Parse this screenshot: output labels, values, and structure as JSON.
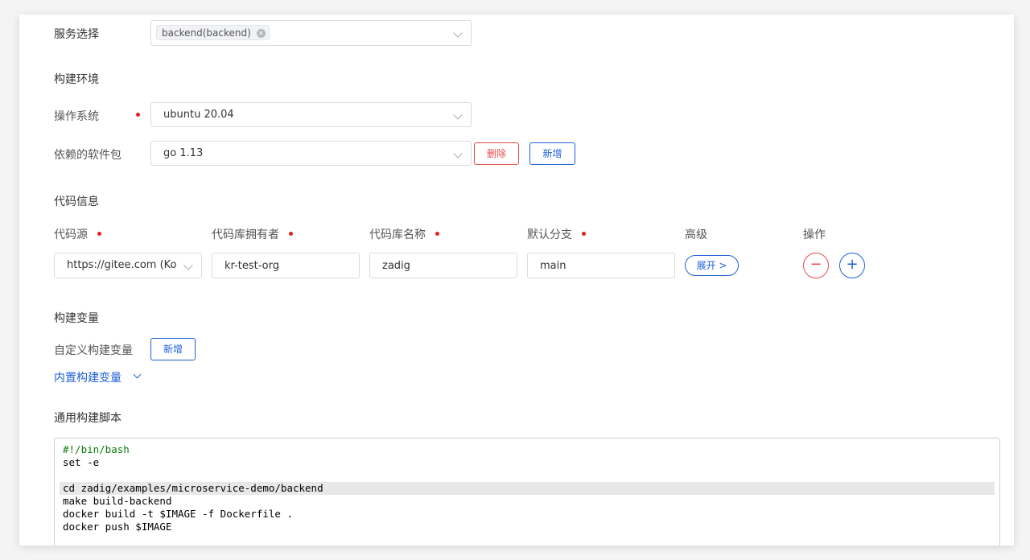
{
  "service": {
    "label": "服务选择",
    "tag": "backend(backend)"
  },
  "build_env": {
    "section_title": "构建环境",
    "os_label": "操作系统",
    "os_value": "ubuntu 20.04",
    "deps_label": "依赖的软件包",
    "deps_value": "go 1.13",
    "delete_label": "删除",
    "add_label": "新增"
  },
  "code_info": {
    "section_title": "代码信息",
    "headers": {
      "source": "代码源",
      "owner": "代码库拥有者",
      "repo": "代码库名称",
      "branch": "默认分支",
      "advanced": "高级",
      "actions": "操作"
    },
    "row": {
      "source": "https://gitee.com (Kode",
      "owner": "kr-test-org",
      "repo": "zadig",
      "branch": "main",
      "expand": "展开 >"
    }
  },
  "build_vars": {
    "section_title": "构建变量",
    "custom_label": "自定义构建变量",
    "add_label": "新增",
    "builtin_label": "内置构建变量"
  },
  "script": {
    "section_title": "通用构建脚本",
    "lines": [
      "#!/bin/bash",
      "set -e",
      "",
      "cd zadig/examples/microservice-demo/backend",
      "make build-backend",
      "docker build -t $IMAGE -f Dockerfile .",
      "docker push $IMAGE"
    ]
  },
  "colors": {
    "accent": "#1f5fd8",
    "danger": "#e74c4c",
    "required": "#e02020"
  }
}
